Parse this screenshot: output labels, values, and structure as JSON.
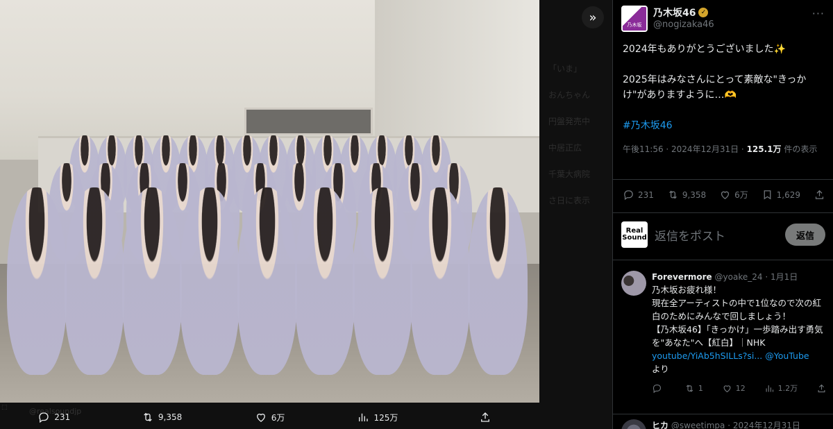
{
  "viewer": {
    "toggle_icon": "chevrons-right-icon",
    "watermark": "@realsoundjp",
    "actions": [
      {
        "icon": "reply-icon",
        "count": "231"
      },
      {
        "icon": "retweet-icon",
        "count": "9,358"
      },
      {
        "icon": "like-icon",
        "count": "6万"
      },
      {
        "icon": "views-icon",
        "count": "125万"
      },
      {
        "icon": "share-icon",
        "count": ""
      }
    ],
    "background_ghost": [
      "「いま」",
      "おんちゃん",
      "円盤発売中",
      "中居正広",
      "千葉大病院",
      "さ日に表示"
    ]
  },
  "tweet": {
    "display_name": "乃木坂46",
    "handle": "@nogizaka46",
    "avatar_label": "乃木坂",
    "text_line1": "2024年もありがとうございました✨",
    "text_line2": "2025年はみなさんにとって素敵な\"きっかけ\"がありますように…🫶",
    "hashtag": "#乃木坂46",
    "time": "午後11:56 · 2024年12月31日 · ",
    "views_value": "125.1万",
    "views_label": " 件の表示",
    "stats": {
      "replies": "231",
      "retweets": "9,358",
      "likes": "6万",
      "bookmarks": "1,629"
    }
  },
  "reply_box": {
    "avatar_line1": "Real",
    "avatar_line2": "Sound",
    "placeholder": "返信をポスト",
    "button": "返信"
  },
  "reply": {
    "name": "Forevermore",
    "handle": "@yoake_24",
    "date": "· 1月1日",
    "line1": "乃木坂お疲れ様！",
    "line2": "現在全アーティストの中で1位なので次の紅白のためにみんなで回しましょう！",
    "line3": "【乃木坂46】「きっかけ」一歩踏み出す勇気を\"あなた\"へ【紅白】｜NHK",
    "link": "youtube/YiAb5hSILLs?si...",
    "mention": "@YouTube",
    "tail": "より",
    "stats": {
      "replies": "",
      "retweets": "1",
      "likes": "12",
      "views": "1.2万"
    }
  },
  "reply2": {
    "name": "ヒカ",
    "handle": "@sweetimpa",
    "date": "· 2024年12月31日"
  }
}
